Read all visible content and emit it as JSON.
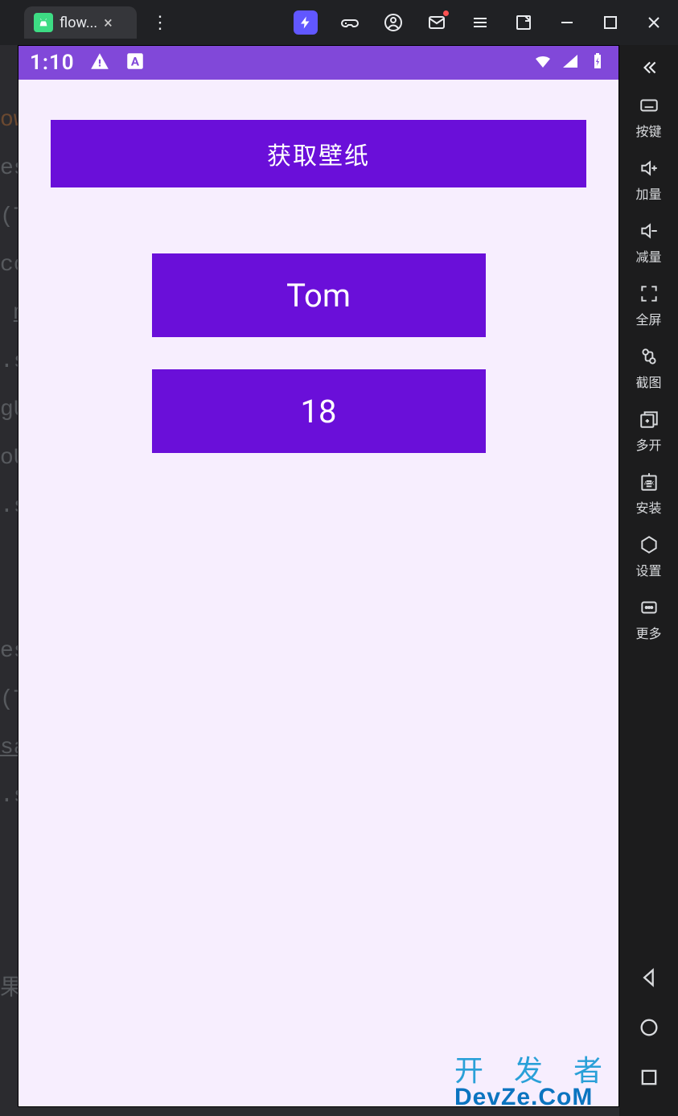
{
  "tab": {
    "title": "flow...",
    "close": "×"
  },
  "statusbar": {
    "time": "1:10"
  },
  "app": {
    "primary_button": "获取壁纸",
    "name_card": "Tom",
    "age_card": "18"
  },
  "sidebar": {
    "items": [
      {
        "id": "keys",
        "label": "按键"
      },
      {
        "id": "volup",
        "label": "加量"
      },
      {
        "id": "voldown",
        "label": "减量"
      },
      {
        "id": "fullscreen",
        "label": "全屏"
      },
      {
        "id": "screenshot",
        "label": "截图"
      },
      {
        "id": "multi",
        "label": "多开"
      },
      {
        "id": "install",
        "label": "安装"
      },
      {
        "id": "settings",
        "label": "设置"
      },
      {
        "id": "more",
        "label": "更多"
      }
    ]
  },
  "watermark": {
    "line1": "开 发 者",
    "line2": "DevZe.CoM"
  }
}
